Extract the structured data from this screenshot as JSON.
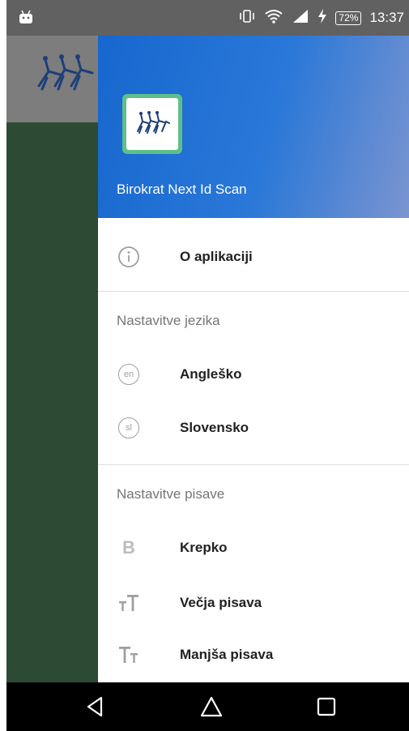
{
  "status_bar": {
    "battery": "72%",
    "time": "13:37"
  },
  "drawer": {
    "app_name": "Birokrat Next Id Scan",
    "items": [
      {
        "label": "O aplikaciji",
        "icon": "info-icon"
      }
    ],
    "sections": [
      {
        "title": "Nastavitve jezika",
        "items": [
          {
            "label": "Angleško",
            "icon": "en-icon",
            "glyph": "en"
          },
          {
            "label": "Slovensko",
            "icon": "sl-icon",
            "glyph": "sl"
          }
        ]
      },
      {
        "title": "Nastavitve pisave",
        "items": [
          {
            "label": "Krepko",
            "icon": "bold-icon",
            "glyph": "B"
          },
          {
            "label": "Večja pisava",
            "icon": "text-increase-icon",
            "glyph": "TT"
          },
          {
            "label": "Manjša pisava",
            "icon": "text-decrease-icon",
            "glyph": "Tt"
          }
        ]
      }
    ]
  },
  "navbar": {
    "back": "back-icon",
    "home": "home-icon",
    "recents": "recents-icon"
  },
  "colors": {
    "status_bar": "#616161",
    "drawer_header_start": "#1767cf",
    "drawer_header_end": "#7b94cf",
    "background_body": "#2d4a34",
    "logo_frame": "#5fbf8a"
  }
}
